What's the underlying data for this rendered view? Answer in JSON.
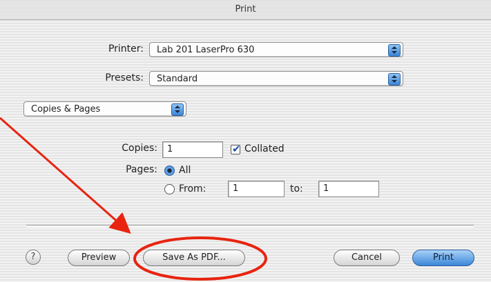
{
  "window": {
    "title": "Print"
  },
  "printer": {
    "label": "Printer:",
    "value": "Lab 201 LaserPro 630"
  },
  "presets": {
    "label": "Presets:",
    "value": "Standard"
  },
  "panel": {
    "value": "Copies & Pages"
  },
  "copies": {
    "label": "Copies:",
    "value": "1",
    "collated_label": "Collated",
    "collated_checked": true
  },
  "pages": {
    "label": "Pages:",
    "all_label": "All",
    "from_label": "From:",
    "from_value": "1",
    "to_label": "to:",
    "to_value": "1",
    "selected": "All"
  },
  "buttons": {
    "help": "?",
    "preview": "Preview",
    "save_pdf": "Save As PDF...",
    "cancel": "Cancel",
    "print": "Print"
  },
  "annotation": {
    "color": "#e8230f",
    "target": "Save As PDF..."
  },
  "colors": {
    "accent": "#3b86d8"
  }
}
